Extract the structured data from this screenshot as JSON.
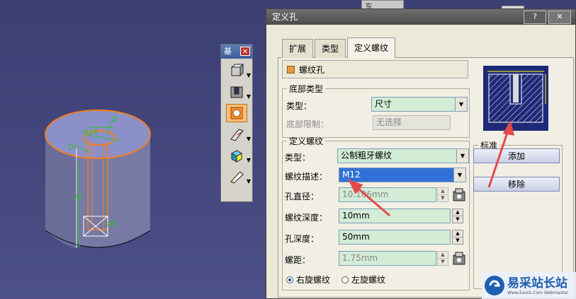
{
  "background": {
    "corner_label": "东"
  },
  "toolbar": {
    "title": "基",
    "close": "✕"
  },
  "dialog": {
    "title": "定义孔",
    "help_button": "?",
    "close_button": "✕",
    "tabs": [
      {
        "label": "扩展",
        "active": false
      },
      {
        "label": "类型",
        "active": false
      },
      {
        "label": "定义螺纹",
        "active": true
      }
    ],
    "threaded_label": "螺纹孔",
    "bottom_type": {
      "legend": "底部类型",
      "type_label": "类型：",
      "type_value": "尺寸",
      "limit_label": "底部限制：",
      "limit_value": "无选择"
    },
    "thread_def": {
      "legend": "定义螺纹",
      "type_label": "类型：",
      "type_value": "公制粗牙螺纹",
      "desc_label": "螺纹描述：",
      "desc_value": "M12",
      "hole_diam_label": "孔直径：",
      "hole_diam_value": "10.106mm",
      "thread_depth_label": "螺纹深度：",
      "thread_depth_value": "10mm",
      "hole_depth_label": "孔深度：",
      "hole_depth_value": "50mm",
      "pitch_label": "螺距：",
      "pitch_value": "1.75mm",
      "right_thread": "右旋螺纹",
      "left_thread": "左旋螺纹"
    },
    "standard": {
      "legend": "标准",
      "add_button": "添加",
      "remove_button": "移除"
    }
  },
  "watermark": {
    "title": "易采站长站",
    "subtitle": "Www.Easck.Com  Webmaster"
  },
  "colors": {
    "accent": "#3272d8",
    "arrow": "#e34a4a",
    "field_green": "#d3ecd6",
    "orange": "#f08020"
  }
}
